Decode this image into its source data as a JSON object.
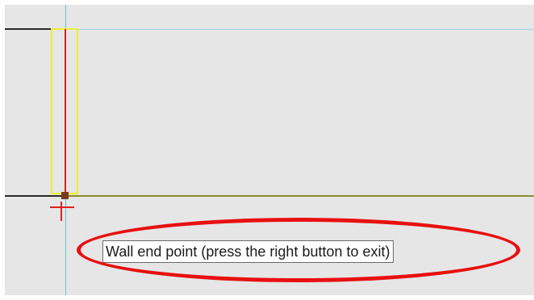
{
  "tooltip": {
    "text": "Wall end point (press the right button to exit)"
  },
  "colors": {
    "canvas_background": "#e6e6e6",
    "guide_line": "#60c4d0",
    "wall_selection": "#f0ee2e",
    "wall_line": "#d82020",
    "highlight": "#e81010"
  },
  "icons": {
    "cursor": "crosshair-cursor-icon"
  }
}
